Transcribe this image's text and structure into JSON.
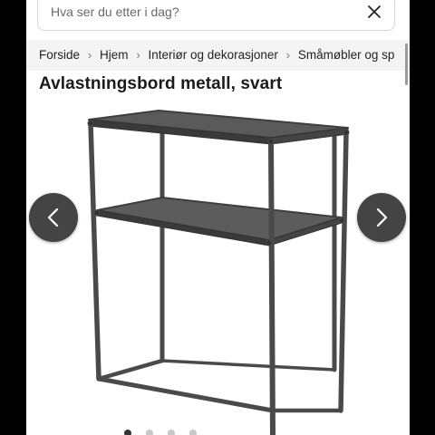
{
  "search": {
    "placeholder": "Hva ser du etter i dag?"
  },
  "icons": {
    "close": "close-icon",
    "prev": "chevron-left-icon",
    "next": "chevron-right-icon",
    "breadcrumb_separator": "chevron-right-icon"
  },
  "breadcrumb": {
    "items": [
      "Forside",
      "Hjem",
      "Interiør og dekorasjoner",
      "Småmøbler og sp"
    ]
  },
  "product": {
    "title": "Avlastningsbord metall, svart"
  },
  "gallery": {
    "image_count": 4,
    "active_index": 0
  },
  "colors": {
    "nav_button": "#444444",
    "breadcrumb_bg": "#f4f4f4",
    "frame": "#4a4a4a"
  }
}
